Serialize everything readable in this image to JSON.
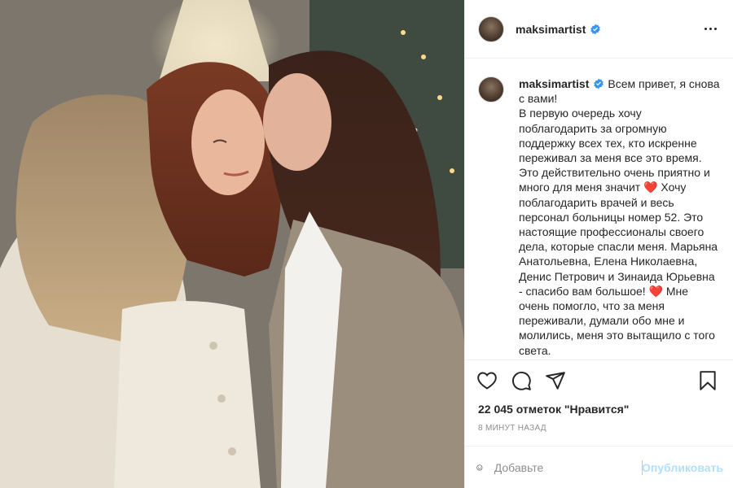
{
  "post": {
    "username": "maksimartist",
    "verified": true,
    "caption": "Всем привет, я снова с вами!\nВ первую очередь хочу поблагодарить за огромную поддержку всех тех, кто искренне переживал за меня все это время. Это действительно очень приятно и много для меня значит ❤️ Хочу поблагодарить врачей и весь персонал больницы номер 52. Это настоящие профессионалы своего дела, которые спасли меня. Марьяна Анатольевна, Елена Николаевна, Денис Петрович и Зинаида Юрьевна - спасибо вам большое! ❤️ Мне очень помогло, что за меня переживали, думали обо мне и молились, меня это вытащило с того света.\nСейчас меня переводят на",
    "likes": "22 045 отметок \"Нравится\"",
    "time": "8 МИНУТ НАЗАД"
  },
  "comment": {
    "placeholder": "Добавьте",
    "publish_label": "Опубликовать"
  },
  "icons": {
    "like": "heart-icon",
    "comment": "comment-icon",
    "share": "share-icon",
    "save": "bookmark-icon",
    "more": "more-options-icon",
    "emoji": "emoji-icon",
    "verified": "verified-badge-icon"
  },
  "colors": {
    "verified": "#3897f0",
    "publish_disabled": "#b2dffc",
    "muted": "#8e8e8e"
  }
}
